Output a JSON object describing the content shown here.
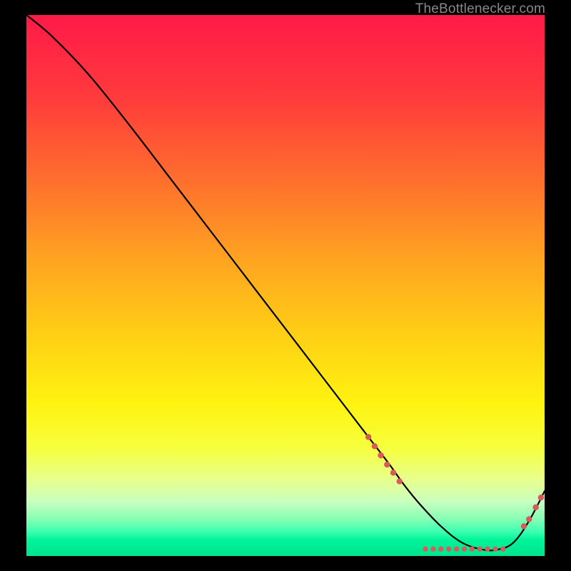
{
  "attribution": "TheBottlenecker.com",
  "chart_data": {
    "type": "line",
    "title": "",
    "xlabel": "",
    "ylabel": "",
    "xlim": [
      0,
      100
    ],
    "ylim": [
      0,
      100
    ],
    "background_gradient": {
      "stops": [
        {
          "pos": 0.0,
          "color": "#ff1a48"
        },
        {
          "pos": 0.15,
          "color": "#ff3a3c"
        },
        {
          "pos": 0.3,
          "color": "#ff6d2e"
        },
        {
          "pos": 0.45,
          "color": "#ffa321"
        },
        {
          "pos": 0.6,
          "color": "#ffd214"
        },
        {
          "pos": 0.72,
          "color": "#fff311"
        },
        {
          "pos": 0.8,
          "color": "#f6ff3d"
        },
        {
          "pos": 0.86,
          "color": "#e7ff8e"
        },
        {
          "pos": 0.9,
          "color": "#c8ffc0"
        },
        {
          "pos": 0.93,
          "color": "#8affb4"
        },
        {
          "pos": 0.955,
          "color": "#3dffb0"
        },
        {
          "pos": 0.97,
          "color": "#00f59a"
        },
        {
          "pos": 1.0,
          "color": "#00e38e"
        }
      ]
    },
    "line": {
      "x": [
        0,
        5,
        12,
        20,
        28,
        36,
        44,
        52,
        60,
        66,
        70,
        73,
        76,
        80,
        84,
        88,
        91,
        94,
        97,
        100
      ],
      "y": [
        100,
        96,
        89,
        79.5,
        69.5,
        59.5,
        49.5,
        39.5,
        29.5,
        22,
        17,
        13,
        9.5,
        5.5,
        2.5,
        1.2,
        1.2,
        2.5,
        6.5,
        12
      ]
    },
    "markers": {
      "color": "#d95a5a",
      "points": [
        {
          "x": 66,
          "y": 22,
          "r": 4.2
        },
        {
          "x": 67.2,
          "y": 20.3,
          "r": 4.2
        },
        {
          "x": 68.4,
          "y": 18.6,
          "r": 4.2
        },
        {
          "x": 69.6,
          "y": 16.9,
          "r": 4.2
        },
        {
          "x": 70.8,
          "y": 15.4,
          "r": 4.2
        },
        {
          "x": 72,
          "y": 13.8,
          "r": 4.2
        },
        {
          "x": 77,
          "y": 1.3,
          "r": 3.6
        },
        {
          "x": 78.5,
          "y": 1.3,
          "r": 3.6
        },
        {
          "x": 80,
          "y": 1.3,
          "r": 3.6
        },
        {
          "x": 81.5,
          "y": 1.3,
          "r": 3.6
        },
        {
          "x": 83,
          "y": 1.3,
          "r": 3.6
        },
        {
          "x": 84.5,
          "y": 1.3,
          "r": 3.6
        },
        {
          "x": 86,
          "y": 1.3,
          "r": 3.6
        },
        {
          "x": 87.5,
          "y": 1.3,
          "r": 3.6
        },
        {
          "x": 89,
          "y": 1.3,
          "r": 3.6
        },
        {
          "x": 90.5,
          "y": 1.3,
          "r": 3.6
        },
        {
          "x": 92,
          "y": 1.3,
          "r": 3.6
        },
        {
          "x": 96,
          "y": 5.5,
          "r": 4.2
        },
        {
          "x": 97,
          "y": 6.8,
          "r": 4.2
        },
        {
          "x": 98.3,
          "y": 9.0,
          "r": 4.2
        },
        {
          "x": 99.3,
          "y": 10.8,
          "r": 4.2
        }
      ]
    }
  }
}
